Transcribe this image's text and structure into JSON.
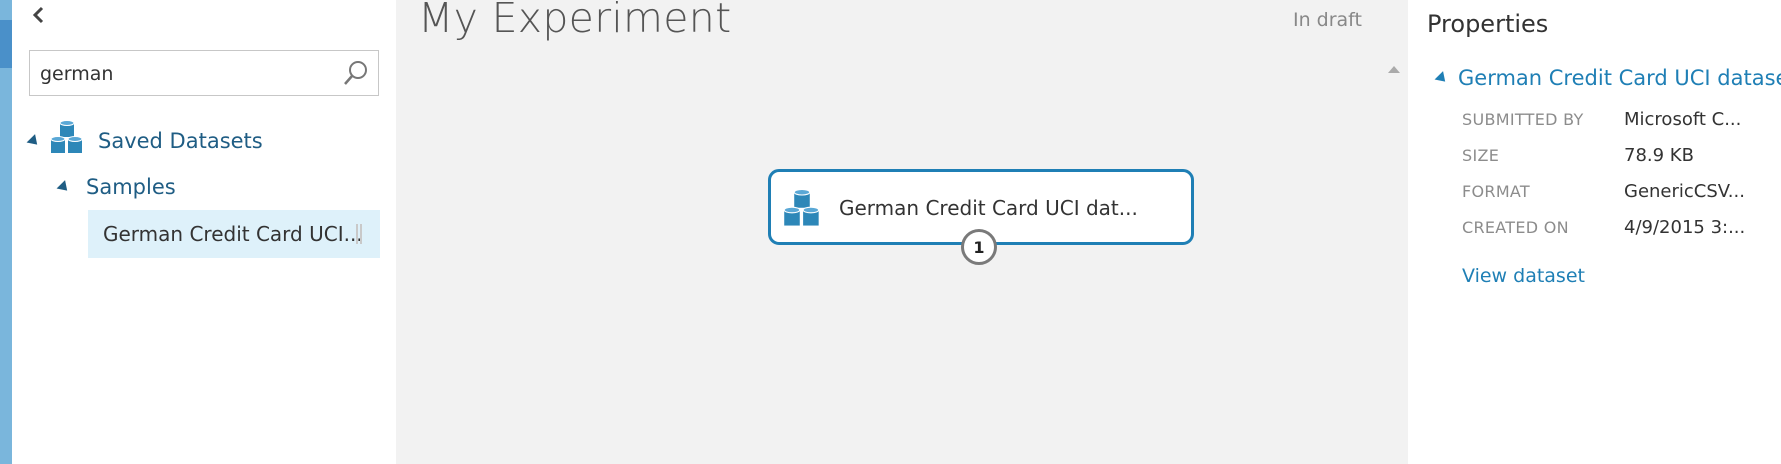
{
  "palette": {
    "search_value": "german",
    "tree": {
      "saved_datasets": "Saved Datasets",
      "samples": "Samples",
      "selected_item": "German Credit Card UCI..."
    }
  },
  "canvas": {
    "title": "My Experiment",
    "status": "In draft",
    "node": {
      "label": "German Credit Card UCI dat...",
      "port_number": "1"
    }
  },
  "properties": {
    "title": "Properties",
    "dataset_name": "German Credit Card UCI dataset",
    "rows": [
      {
        "key": "SUBMITTED BY",
        "value": "Microsoft C..."
      },
      {
        "key": "SIZE",
        "value": "78.9 KB"
      },
      {
        "key": "FORMAT",
        "value": "GenericCSV..."
      },
      {
        "key": "CREATED ON",
        "value": "4/9/2015 3:..."
      }
    ],
    "view_link": "View dataset"
  },
  "colors": {
    "accent": "#1f7fb5",
    "tree_text": "#1f5d84",
    "selected_bg": "#def1fa",
    "canvas_bg": "#f2f2f2"
  }
}
